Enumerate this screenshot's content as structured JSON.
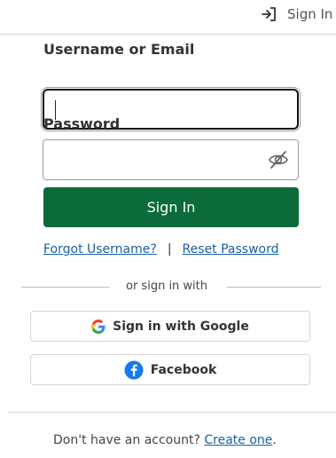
{
  "header": {
    "sign_in_label": "Sign In"
  },
  "form": {
    "username_label": "Username or Email",
    "username_value": "",
    "password_label": "Password",
    "password_value": "",
    "submit_label": "Sign In"
  },
  "links": {
    "forgot_username": "Forgot Username?",
    "separator": "|",
    "reset_password": "Reset Password"
  },
  "divider": {
    "text": "or sign in with"
  },
  "social": {
    "google_label": "Sign in with Google",
    "facebook_label": "Facebook"
  },
  "footer": {
    "prompt": "Don't have an account?",
    "create_link": "Create one",
    "period": "."
  },
  "colors": {
    "primary": "#0b6b3a",
    "link": "#1a5fa0",
    "facebook": "#1877f2"
  },
  "icons": {
    "header": "sign-in-arrow-icon",
    "password_toggle": "eye-slash-icon",
    "google": "google-g-icon",
    "facebook": "facebook-f-icon"
  }
}
